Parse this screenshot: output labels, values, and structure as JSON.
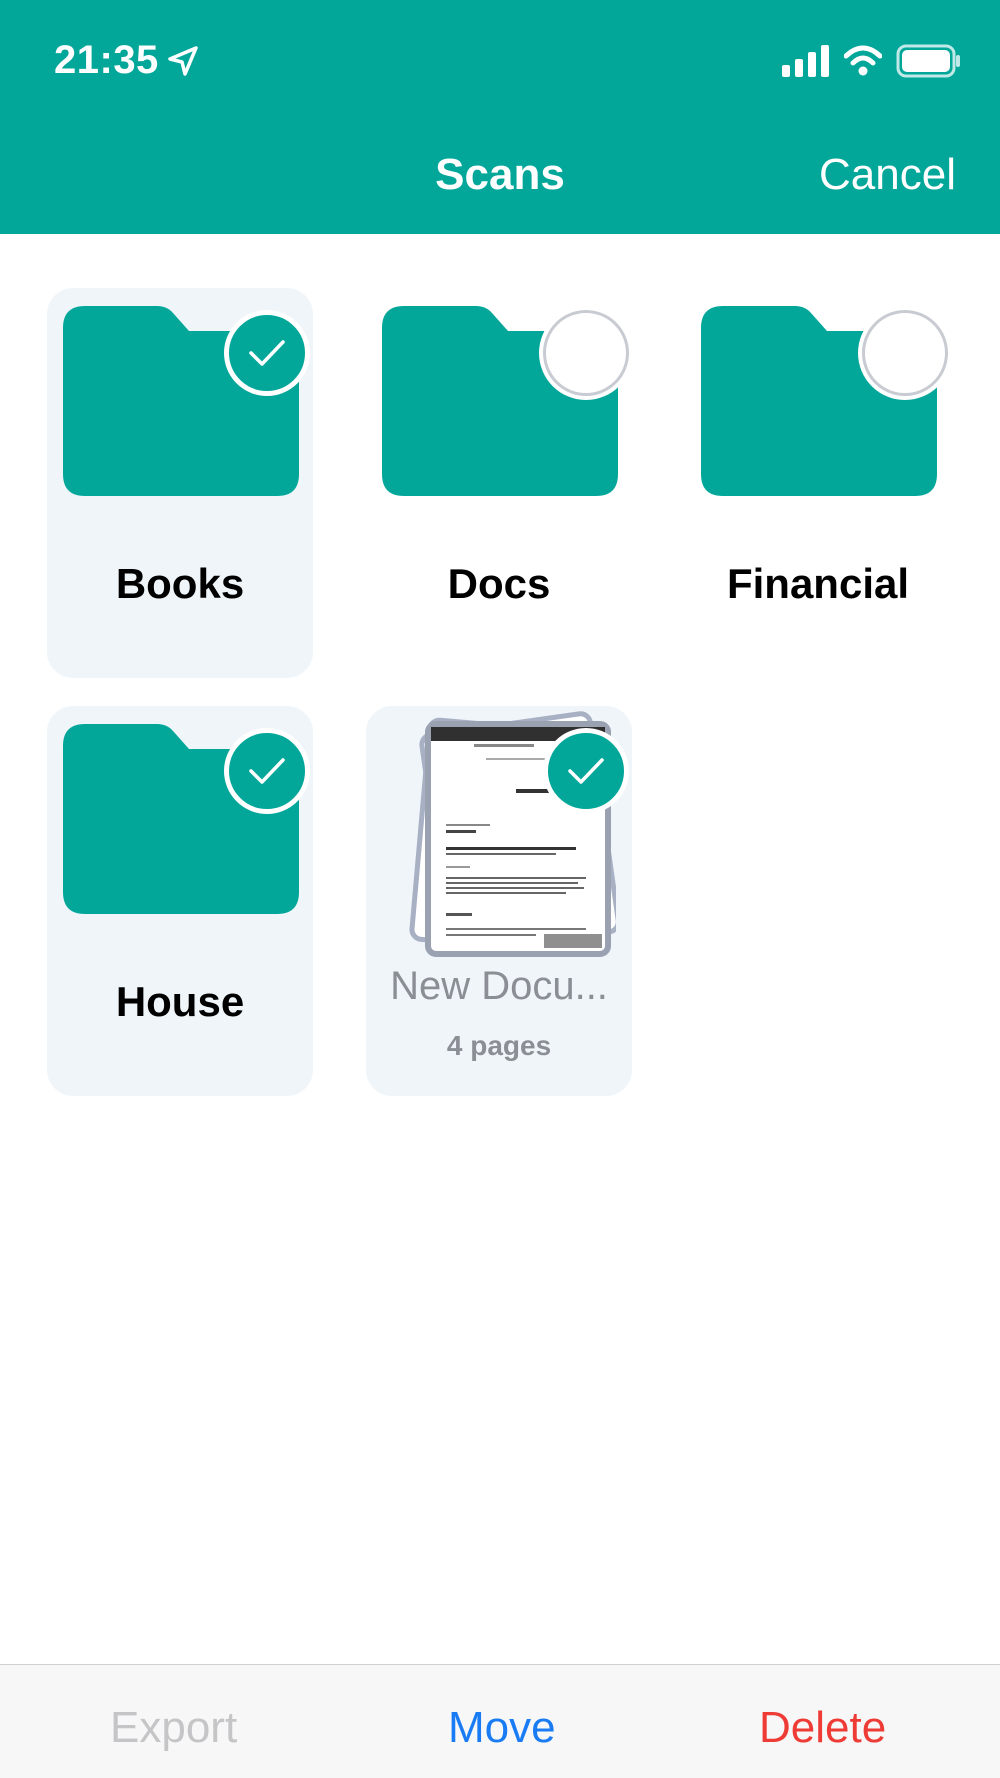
{
  "status_bar": {
    "time": "21:35"
  },
  "nav": {
    "title": "Scans",
    "cancel_label": "Cancel"
  },
  "items": [
    {
      "label": "Books",
      "type": "folder",
      "selected": true
    },
    {
      "label": "Docs",
      "type": "folder",
      "selected": false
    },
    {
      "label": "Financial",
      "type": "folder",
      "selected": false
    },
    {
      "label": "House",
      "type": "folder",
      "selected": true
    },
    {
      "label": "New Docu...",
      "type": "document",
      "pages": "4 pages",
      "selected": true
    }
  ],
  "toolbar": {
    "export_label": "Export",
    "move_label": "Move",
    "delete_label": "Delete"
  },
  "colors": {
    "accent": "#02a79a",
    "selected_tile": "#eff5f9",
    "move": "#1a7cf5",
    "delete": "#ee3b36",
    "disabled": "#c5c5c7"
  }
}
